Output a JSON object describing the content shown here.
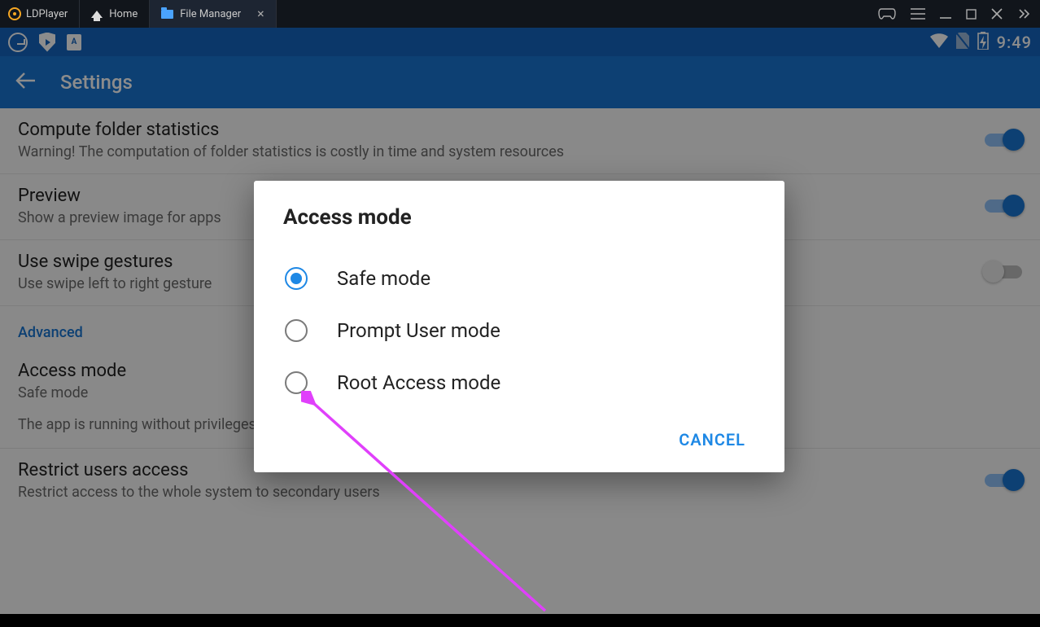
{
  "titlebar": {
    "app_name": "LDPlayer",
    "tabs": [
      {
        "label": "Home",
        "active": false
      },
      {
        "label": "File Manager",
        "active": true
      }
    ]
  },
  "statusbar": {
    "clock": "9:49",
    "a_badge": "A"
  },
  "appbar": {
    "title": "Settings"
  },
  "settings": {
    "compute_stats": {
      "title": "Compute folder statistics",
      "sub": "Warning! The computation of folder statistics is costly in time and system resources",
      "on": true
    },
    "preview": {
      "title": "Preview",
      "sub": "Show a preview image for apps",
      "on": true
    },
    "swipe": {
      "title": "Use swipe gestures",
      "sub": "Use swipe left to right gesture",
      "on": false
    },
    "section_advanced": "Advanced",
    "access_mode": {
      "title": "Access mode",
      "sub": "Safe mode",
      "desc": "The app is running without privileges and the only accessible file systems are the storage volumes (SD cards and USB)"
    },
    "restrict": {
      "title": "Restrict users access",
      "sub": "Restrict access to the whole system to secondary users",
      "on": true
    }
  },
  "dialog": {
    "title": "Access mode",
    "options": [
      {
        "label": "Safe mode",
        "checked": true
      },
      {
        "label": "Prompt User mode",
        "checked": false
      },
      {
        "label": "Root Access mode",
        "checked": false
      }
    ],
    "cancel": "CANCEL"
  }
}
